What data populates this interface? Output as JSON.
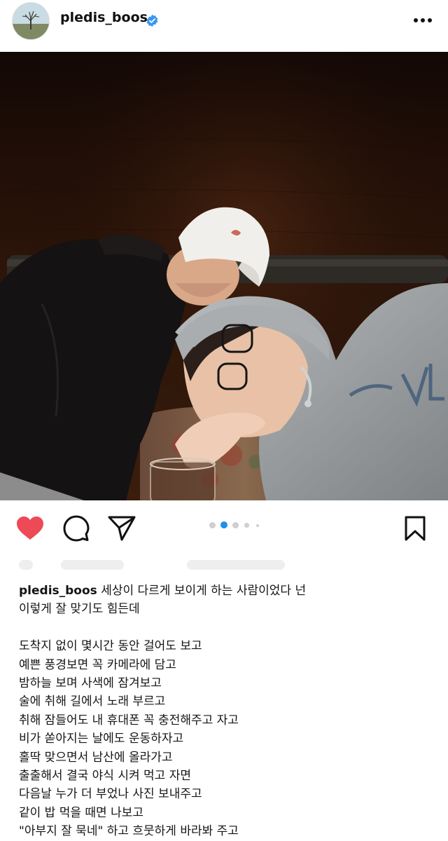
{
  "post": {
    "username": "pledis_boos",
    "verified": true,
    "more_label": "more options",
    "carousel": {
      "total": 5,
      "active_index": 1
    }
  },
  "icons": {
    "avatar": "tree-landscape-avatar",
    "verified": "verified-badge-icon",
    "more": "ellipsis-icon",
    "like": "heart-icon",
    "comment": "comment-bubble-icon",
    "share": "paper-plane-icon",
    "save": "bookmark-icon"
  },
  "colors": {
    "like": "#ed4956",
    "verified": "#3897f0",
    "active_dot": "#1f8ef0",
    "inactive_dot": "#cfcfcf"
  },
  "caption": {
    "username": "pledis_boos",
    "first_line_text": " 세상이 다르게 보이게 하는 사람이었다 넌",
    "lines": [
      "이렇게 잘 맞기도 힘든데",
      "",
      "도착지 없이 몇시간 동안 걸어도 보고",
      "예쁜 풍경보면 꼭 카메라에 담고",
      "밤하늘 보며 사색에 잠겨보고",
      "술에 취해 길에서 노래 부르고",
      "취해 잠들어도 내 휴대폰 꼭 충전해주고 자고",
      "비가 쏟아지는 날에도 운동하자고",
      "홀딱 맞으면서 남산에 올라가고",
      "출출해서 결국 야식 시켜 먹고 자면",
      "다음날 누가 더 부었나 사진 보내주고",
      "같이 밥 먹을 때면 나보고",
      "\"아부지 잘 묵네\" 하고 흐뭇하게 바라봐 주고"
    ]
  }
}
